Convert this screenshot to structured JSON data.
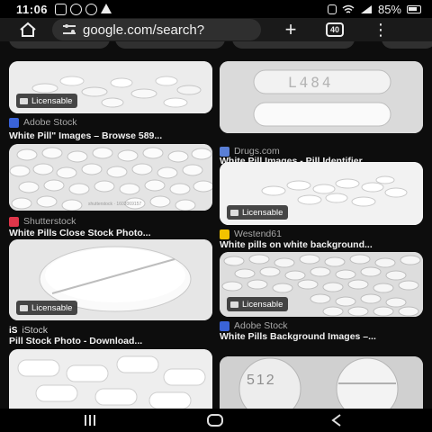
{
  "status_bar": {
    "time": "11:06",
    "battery": "85%"
  },
  "browser": {
    "url": "google.com/search?",
    "tab_count": "40"
  },
  "results": [
    {
      "source": "Adobe Stock",
      "title": "White Pill\" Images – Browse 589...",
      "licensable": "Licensable",
      "favicon_color": "#3a63d8"
    },
    {
      "source": "Drugs.com",
      "title": "White Pill Images - Pill Identifier ...",
      "imprint": "L484",
      "favicon_color": "#5a7fd6"
    },
    {
      "source": "Shutterstock",
      "title": "White Pills Close Stock Photo...",
      "watermark": "shutterstock · 1602069157",
      "favicon_color": "#e0364a"
    },
    {
      "source": "Westend61",
      "title": "White pills on white background...",
      "licensable": "Licensable",
      "favicon_color": "#f2c200"
    },
    {
      "source": "iStock",
      "title": "Pill Stock Photo - Download...",
      "licensable": "Licensable",
      "favicon_text": "iS"
    },
    {
      "source": "Adobe Stock",
      "title": "White Pills Background Images –...",
      "licensable": "Licensable",
      "favicon_color": "#3a63d8"
    },
    {
      "source": "",
      "title": ""
    },
    {
      "source": "",
      "title": "",
      "imprint": "512"
    }
  ]
}
